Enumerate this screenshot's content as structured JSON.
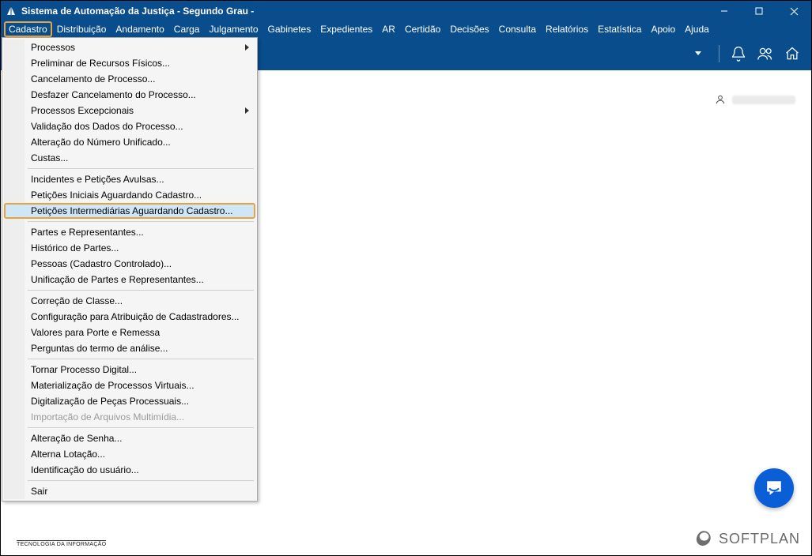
{
  "window": {
    "title": "Sistema de Automação da Justiça - Segundo Grau -"
  },
  "menubar": [
    "Cadastro",
    "Distribuição",
    "Andamento",
    "Carga",
    "Julgamento",
    "Gabinetes",
    "Expedientes",
    "AR",
    "Certidão",
    "Decisões",
    "Consulta",
    "Relatórios",
    "Estatística",
    "Apoio",
    "Ajuda"
  ],
  "dropdown": {
    "groups": [
      [
        {
          "label": "Processos",
          "submenu": true
        },
        {
          "label": "Preliminar de Recursos Físicos..."
        },
        {
          "label": "Cancelamento de Processo..."
        },
        {
          "label": "Desfazer Cancelamento do Processo..."
        },
        {
          "label": "Processos Excepcionais",
          "submenu": true
        },
        {
          "label": "Validação dos Dados do Processo..."
        },
        {
          "label": "Alteração do Número Unificado..."
        },
        {
          "label": "Custas..."
        }
      ],
      [
        {
          "label": "Incidentes e Petições Avulsas..."
        },
        {
          "label": "Petições Iniciais Aguardando Cadastro..."
        },
        {
          "label": "Petições Intermediárias Aguardando Cadastro...",
          "highlight": true
        }
      ],
      [
        {
          "label": "Partes e Representantes..."
        },
        {
          "label": "Histórico de Partes..."
        },
        {
          "label": "Pessoas (Cadastro Controlado)..."
        },
        {
          "label": "Unificação de Partes e Representantes..."
        }
      ],
      [
        {
          "label": "Correção de Classe..."
        },
        {
          "label": "Configuração para Atribuição de Cadastradores..."
        },
        {
          "label": "Valores para Porte e Remessa"
        },
        {
          "label": "Perguntas do termo de análise..."
        }
      ],
      [
        {
          "label": "Tornar Processo Digital..."
        },
        {
          "label": "Materialização de Processos Virtuais..."
        },
        {
          "label": "Digitalização de Peças Processuais..."
        },
        {
          "label": "Importação de Arquivos Multimídia...",
          "disabled": true
        }
      ],
      [
        {
          "label": "Alteração de Senha..."
        },
        {
          "label": "Alterna Lotação..."
        },
        {
          "label": "Identificação do usuário..."
        }
      ],
      [
        {
          "label": "Sair"
        }
      ]
    ]
  },
  "footer": {
    "tag": "TECNOLOGIA DA INFORMAÇÃO"
  },
  "brand": {
    "name": "SOFTPLAN"
  }
}
